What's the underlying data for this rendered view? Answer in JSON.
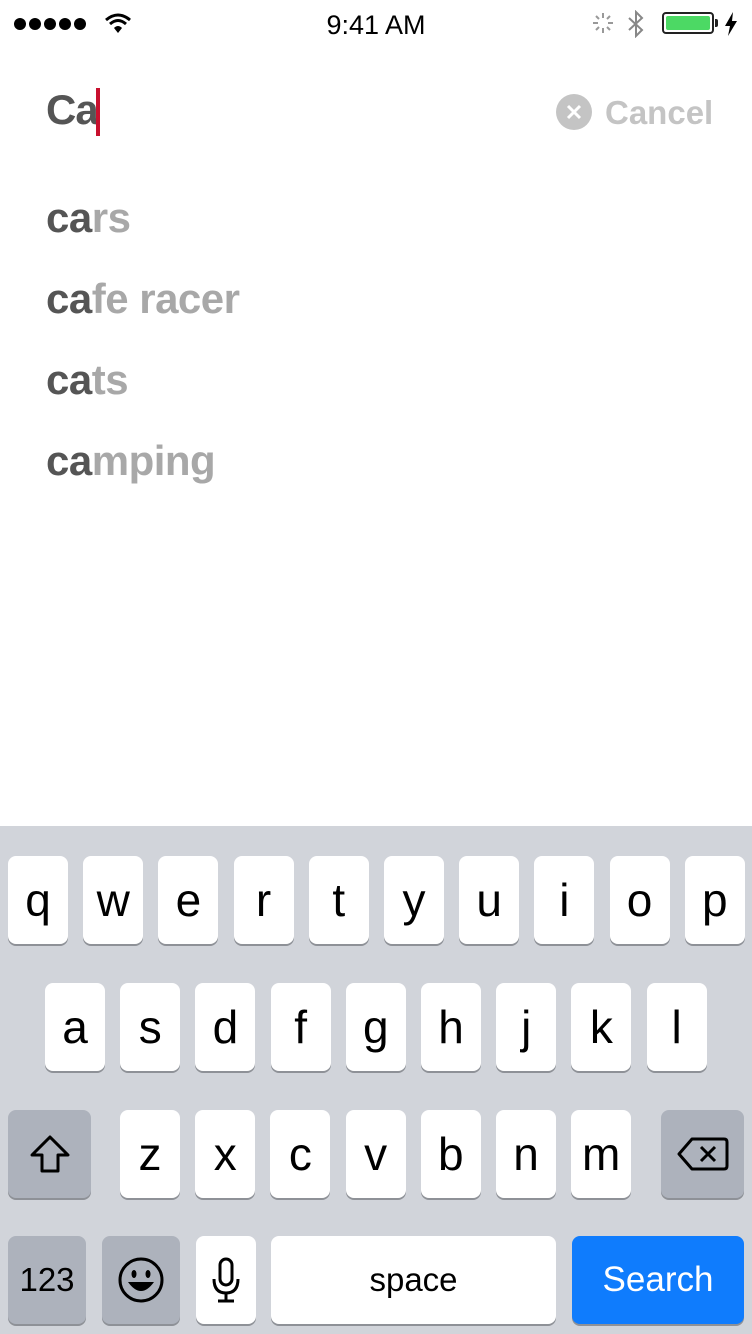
{
  "status_bar": {
    "time": "9:41 AM",
    "signal_bars": 5,
    "battery_level": 1.0,
    "battery_color": "#4cd964",
    "icons": [
      "signal-dots-icon",
      "wifi-icon",
      "activity-spinner-icon",
      "bluetooth-icon",
      "battery-icon",
      "charging-bolt-icon"
    ]
  },
  "search": {
    "value": "Ca",
    "clear_icon": "clear-circle-x-icon",
    "cancel_label": "Cancel",
    "caret_color": "#c8102e"
  },
  "suggestions": [
    {
      "typed": "ca",
      "rest": "rs"
    },
    {
      "typed": "ca",
      "rest": "fe racer"
    },
    {
      "typed": "ca",
      "rest": "ts"
    },
    {
      "typed": "ca",
      "rest": "mping"
    }
  ],
  "keyboard": {
    "row1": [
      "q",
      "w",
      "e",
      "r",
      "t",
      "y",
      "u",
      "i",
      "o",
      "p"
    ],
    "row2": [
      "a",
      "s",
      "d",
      "f",
      "g",
      "h",
      "j",
      "k",
      "l"
    ],
    "row3": [
      "z",
      "x",
      "c",
      "v",
      "b",
      "n",
      "m"
    ],
    "numbers_label": "123",
    "space_label": "space",
    "search_label": "Search",
    "search_color": "#0f7cfd",
    "shift_icon": "shift-arrow-icon",
    "delete_icon": "backspace-icon",
    "emoji_icon": "emoji-face-icon",
    "mic_icon": "microphone-icon"
  }
}
